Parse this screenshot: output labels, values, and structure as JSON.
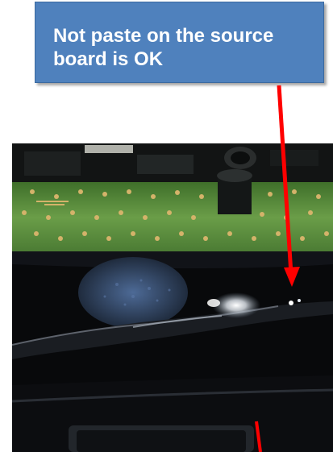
{
  "callout": {
    "text": "Not paste on the source board is OK"
  },
  "photo": {
    "subject": "source board with black tape"
  },
  "colors": {
    "callout_fill": "#4f81bd",
    "callout_text": "#ffffff",
    "arrow": "#ff0000",
    "pcb_green": "#5a8d3c"
  }
}
